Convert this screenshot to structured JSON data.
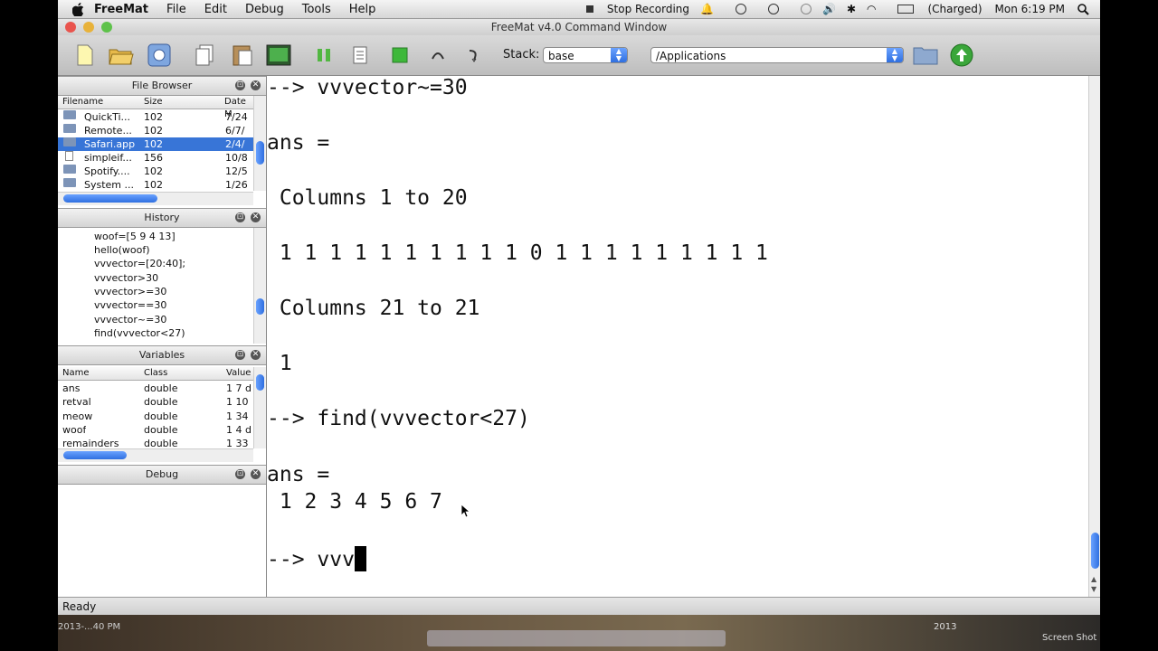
{
  "menubar": {
    "app_name": "FreeMat",
    "items": [
      "File",
      "Edit",
      "Debug",
      "Tools",
      "Help"
    ],
    "stop_recording": "Stop Recording",
    "battery": "(Charged)",
    "clock": "Mon 6:19 PM"
  },
  "window": {
    "title": "FreeMat v4.0 Command Window"
  },
  "toolbar": {
    "stack_label": "Stack:",
    "stack_value": "base",
    "path_value": "/Applications"
  },
  "file_browser": {
    "title": "File Browser",
    "columns": [
      "Filename",
      "Size",
      "Date M"
    ],
    "rows": [
      {
        "name": "QuickTi...",
        "size": "102",
        "date": "7/24",
        "type": "folder"
      },
      {
        "name": "Remote...",
        "size": "102",
        "date": "6/7/",
        "type": "folder"
      },
      {
        "name": "Safari.app",
        "size": "102",
        "date": "2/4/",
        "type": "folder"
      },
      {
        "name": "simpleif...",
        "size": "156",
        "date": "10/8",
        "type": "file"
      },
      {
        "name": "Spotify....",
        "size": "102",
        "date": "12/5",
        "type": "folder"
      },
      {
        "name": "System ...",
        "size": "102",
        "date": "1/26",
        "type": "folder"
      }
    ]
  },
  "history": {
    "title": "History",
    "items": [
      "woof=[5 9 4 13]",
      "hello(woof)",
      "vvvector=[20:40];",
      "vvvector>30",
      "vvvector>=30",
      "vvvector==30",
      "vvvector~=30",
      "find(vvvector<27)"
    ]
  },
  "variables": {
    "title": "Variables",
    "columns": [
      "Name",
      "Class",
      "Value"
    ],
    "rows": [
      {
        "name": "ans",
        "class": "double",
        "value": "1 7 d"
      },
      {
        "name": "retval",
        "class": "double",
        "value": "1 10"
      },
      {
        "name": "meow",
        "class": "double",
        "value": "1 34"
      },
      {
        "name": "woof",
        "class": "double",
        "value": "1 4 d"
      },
      {
        "name": "remainders",
        "class": "double",
        "value": "1 33"
      }
    ]
  },
  "debug": {
    "title": "Debug"
  },
  "console": {
    "lines": [
      "--> vvvector~=30",
      "ans =",
      " Columns 1 to 20",
      " 1 1 1 1 1 1 1 1 1 1 0 1 1 1 1 1 1 1 1 1",
      " Columns 21 to 21",
      " 1",
      "--> find(vvvector<27)",
      "ans =",
      " 1 2 3 4 5 6 7",
      "--> vvv"
    ]
  },
  "status": {
    "text": "Ready"
  },
  "desktop": {
    "screenshot_label": "Screen Shot",
    "screenshot_time": "2013-...40 PM",
    "year": "2013"
  },
  "colors": {
    "selection": "#3875d7",
    "accent": "#2f6fe0"
  }
}
